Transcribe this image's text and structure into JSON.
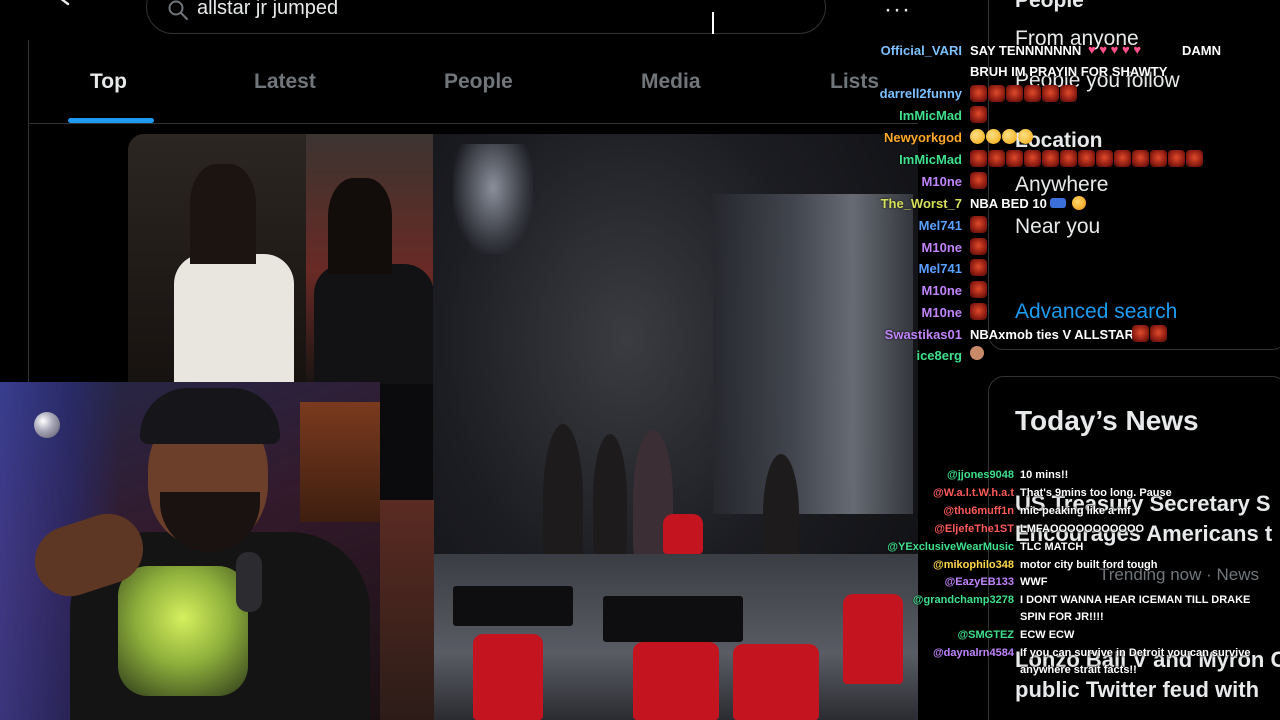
{
  "search": {
    "query": "allstar jr jumped"
  },
  "tabs": [
    {
      "label": "Top",
      "active": true
    },
    {
      "label": "Latest",
      "active": false
    },
    {
      "label": "People",
      "active": false
    },
    {
      "label": "Media",
      "active": false
    },
    {
      "label": "Lists",
      "active": false
    }
  ],
  "filters": {
    "people_heading": "People",
    "people_options": [
      "From anyone",
      "People you follow"
    ],
    "location_heading": "Location",
    "location_options": [
      "Anywhere",
      "Near you"
    ],
    "advanced_search": "Advanced search"
  },
  "news": {
    "heading": "Today’s News",
    "story1_line1": "US Treasury Secretary S",
    "story1_line2": "Encourages Americans t",
    "story1_meta": "Trending now · News",
    "story2_line1": "Lonzo Ball V and Myron C",
    "story2_line2": "public Twitter feud with"
  },
  "chat_top": [
    {
      "user": "Official_VARI",
      "color": "#7cc1ff",
      "msg": "SAY TENNNNNNN",
      "msg2": "DAMN",
      "line2": "BRUH IM PRAYIN FOR SHAWTY"
    },
    {
      "user": "darrell2funny",
      "color": "#7cc1ff",
      "msg": ""
    },
    {
      "user": "ImMicMad",
      "color": "#3fe08c",
      "msg": ""
    },
    {
      "user": "Newyorkgod",
      "color": "#ffa726",
      "msg": ""
    },
    {
      "user": "ImMicMad",
      "color": "#3fe08c",
      "msg": ""
    },
    {
      "user": "M10ne",
      "color": "#c084fc",
      "msg": ""
    },
    {
      "user": "The_Worst_7",
      "color": "#d6e05a",
      "msg": "NBA BED 10"
    },
    {
      "user": "Mel741",
      "color": "#5aa0ff",
      "msg": ""
    },
    {
      "user": "M10ne",
      "color": "#c084fc",
      "msg": ""
    },
    {
      "user": "Mel741",
      "color": "#5aa0ff",
      "msg": ""
    },
    {
      "user": "M10ne",
      "color": "#c084fc",
      "msg": ""
    },
    {
      "user": "M10ne",
      "color": "#c084fc",
      "msg": ""
    },
    {
      "user": "Swastikas01",
      "color": "#c084fc",
      "msg": "NBAxmob ties V ALLSTAR"
    },
    {
      "user": "ice8erg",
      "color": "#3fe08c",
      "msg": ""
    }
  ],
  "chat_bottom": [
    {
      "user": "@jjones9048",
      "color": "#3fe08c",
      "msg": "10 mins!!"
    },
    {
      "user": "@W.a.l.t.W.h.a.t",
      "color": "#ff5a5a",
      "msg": "That's 9mins too long. Pause"
    },
    {
      "user": "@thu6muff1n",
      "color": "#ff5a5a",
      "msg": "mic peaking like a mf"
    },
    {
      "user": "@EljefeThe1ST",
      "color": "#ff5a5a",
      "msg": "LMFAOOOOOOOOOOO"
    },
    {
      "user": "@YExclusiveWearMusic",
      "color": "#3fe08c",
      "msg": "TLC MATCH"
    },
    {
      "user": "@mikophilo348",
      "color": "#ffd84a",
      "msg": "motor city built ford tough"
    },
    {
      "user": "@EazyEB133",
      "color": "#c084fc",
      "msg": "WWF"
    },
    {
      "user": "@grandchamp3278",
      "color": "#3fe08c",
      "msg": "I DONT WANNA HEAR ICEMAN TILL DRAKE",
      "line2": "SPIN FOR JR!!!!"
    },
    {
      "user": "@SMGTEZ",
      "color": "#3fe08c",
      "msg": "ECW ECW"
    },
    {
      "user": "@daynalrn4584",
      "color": "#c084fc",
      "msg": "If you can survive in Detroit you can survive",
      "line2": "anywhere strait facts!!"
    }
  ],
  "icons": {
    "back": "back-arrow-icon",
    "search": "search-icon",
    "more": "more-icon"
  },
  "colors": {
    "accent": "#1d9bf0",
    "border": "#2f3336",
    "muted": "#71767b"
  }
}
